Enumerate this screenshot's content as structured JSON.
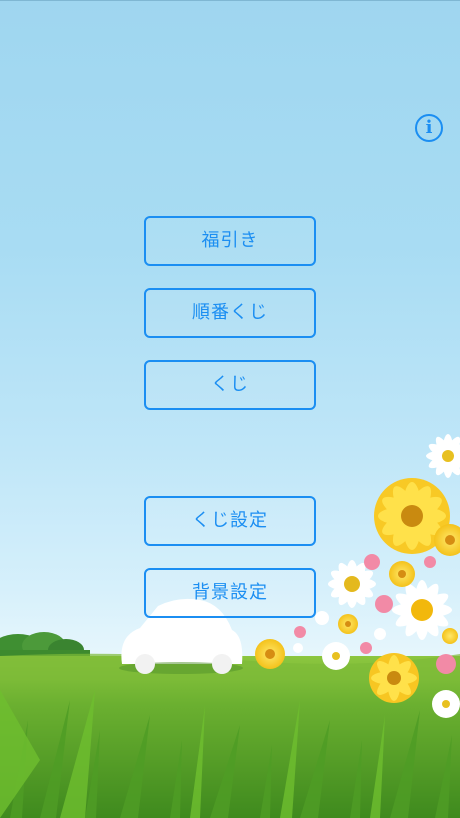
{
  "menu": {
    "fukubiki": "福引き",
    "junban_kuji": "順番くじ",
    "kuji": "くじ",
    "kuji_settei": "くじ設定",
    "haikei_settei": "背景設定"
  },
  "info": {
    "glyph": "i"
  },
  "colors": {
    "accent": "#1b8ef2",
    "sky_top": "#9fd6f0",
    "grass": "#5aa82c"
  }
}
